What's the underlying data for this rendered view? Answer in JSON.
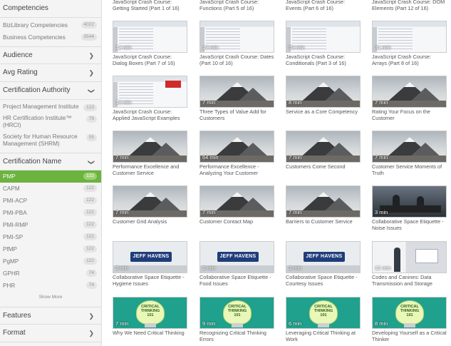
{
  "sidebar": {
    "competencies": {
      "title": "Competencies",
      "items": [
        {
          "label": "BizLibrary Competencies",
          "count": "4022"
        },
        {
          "label": "Business Competencies",
          "count": "3544"
        }
      ]
    },
    "audience": {
      "title": "Audience"
    },
    "avg_rating": {
      "title": "Avg Rating"
    },
    "certification_authority": {
      "title": "Certification Authority",
      "items": [
        {
          "label": "Project Management Institute",
          "count": "123"
        },
        {
          "label": "HR Certification Institute™ (HRCI)",
          "count": "79"
        },
        {
          "label": "Society for Human Resource Management (SHRM)",
          "count": "55"
        }
      ]
    },
    "certification_name": {
      "title": "Certification Name",
      "items": [
        {
          "label": "PMP",
          "count": "122"
        },
        {
          "label": "CAPM",
          "count": "122"
        },
        {
          "label": "PMI-ACP",
          "count": "122"
        },
        {
          "label": "PMI-PBA",
          "count": "122"
        },
        {
          "label": "PMI-RMP",
          "count": "122"
        },
        {
          "label": "PMI-SP",
          "count": "122"
        },
        {
          "label": "PfMP",
          "count": "122"
        },
        {
          "label": "PgMP",
          "count": "122"
        },
        {
          "label": "GPHR",
          "count": "74"
        },
        {
          "label": "PHR",
          "count": "74"
        }
      ],
      "show_more": "Show More"
    },
    "features": {
      "title": "Features"
    },
    "format": {
      "title": "Format"
    }
  },
  "cards": [
    {
      "title": "JavaScript Crash Course: Getting Started (Part 1 of 16)",
      "duration": "",
      "thumb": "code"
    },
    {
      "title": "JavaScript Crash Course: Functions (Part 5 of 16)",
      "duration": "",
      "thumb": "code"
    },
    {
      "title": "JavaScript Crash Course: Events (Part 6 of 16)",
      "duration": "",
      "thumb": "code"
    },
    {
      "title": "JavaScript Crash Course: DOM Elements (Part 12 of 16)",
      "duration": "",
      "thumb": "code"
    },
    {
      "title": "JavaScript Crash Course: Dialog Boxes (Part 7 of 16)",
      "duration": "12 min",
      "thumb": "code"
    },
    {
      "title": "JavaScript Crash Course: Dates (Part 10 of 16)",
      "duration": "19 min",
      "thumb": "code"
    },
    {
      "title": "JavaScript Crash Course: Conditionals (Part 3 of 16)",
      "duration": "59 min",
      "thumb": "code"
    },
    {
      "title": "JavaScript Crash Course: Arrays (Part 8 of 16)",
      "duration": "31 min",
      "thumb": "code"
    },
    {
      "title": "JavaScript Crash Course: Applied JavaScript Examples",
      "duration": "18 min",
      "thumb": "code-red"
    },
    {
      "title": "Three Types of Value Add for Customers",
      "duration": "7 min",
      "thumb": "mountain"
    },
    {
      "title": "Service as a Core Competency",
      "duration": "8 min",
      "thumb": "mountain"
    },
    {
      "title": "Rating Your Focus on the Customer",
      "duration": "7 min",
      "thumb": "mountain"
    },
    {
      "title": "Performance Excellence and Customer Service",
      "duration": "7 min",
      "thumb": "mountain"
    },
    {
      "title": "Performance Excellence - Analyzing Your Customer",
      "duration": "64 min",
      "thumb": "mountain"
    },
    {
      "title": "Customers Come Second",
      "duration": "7 min",
      "thumb": "mountain"
    },
    {
      "title": "Customer Service Moments of Truth",
      "duration": "7 min",
      "thumb": "mountain"
    },
    {
      "title": "Customer Grid Analysis",
      "duration": "7 min",
      "thumb": "mountain"
    },
    {
      "title": "Customer Contact Map",
      "duration": "7 min",
      "thumb": "mountain"
    },
    {
      "title": "Barriers to Customer Service",
      "duration": "7 min",
      "thumb": "mountain"
    },
    {
      "title": "Collaborative Space Etiquette - Noise Issues",
      "duration": "3 min",
      "thumb": "office"
    },
    {
      "title": "Collaborative Space Etiquette - Hygiene Issues",
      "duration": "3 min",
      "thumb": "jeff"
    },
    {
      "title": "Collaborative Space Etiquette - Food Issues",
      "duration": "2 min",
      "thumb": "jeff"
    },
    {
      "title": "Collaborative Space Etiquette - Courtesy Issues",
      "duration": "2 min",
      "thumb": "jeff"
    },
    {
      "title": "Codes and Canines: Data Transmission and Storage",
      "duration": "12 min",
      "thumb": "lab"
    },
    {
      "title": "Why We Need Critical Thinking",
      "duration": "7 min",
      "thumb": "critical"
    },
    {
      "title": "Recognizing Critical Thinking Errors",
      "duration": "9 min",
      "thumb": "critical"
    },
    {
      "title": "Leveraging Critical Thinking at Work",
      "duration": "6 min",
      "thumb": "critical"
    },
    {
      "title": "Developing Yourself as a Critical Thinker",
      "duration": "8 min",
      "thumb": "critical"
    }
  ],
  "thumb_text": {
    "jeff_logo": "JEFF HAVENS",
    "critical_bulb": "CRITICAL THINKING 101"
  },
  "colors": {
    "active_filter": "#6cb33f",
    "sidebar_bg": "#f4f4f4"
  }
}
